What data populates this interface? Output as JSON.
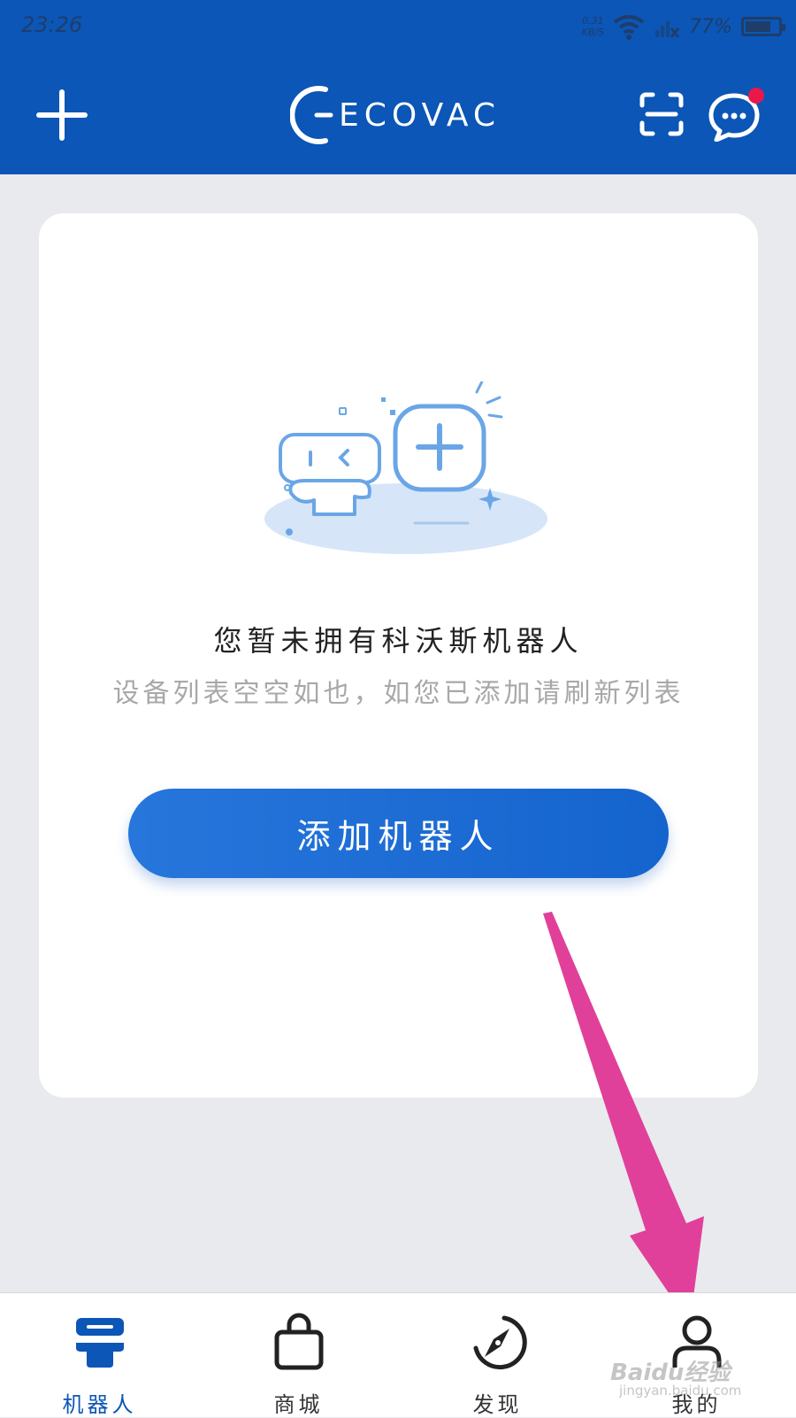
{
  "status_bar": {
    "time": "23:26",
    "net_speed_value": "0.31",
    "net_speed_unit": "KB/S",
    "battery_text": "77%",
    "battery_level": 0.77
  },
  "header": {
    "logo_text": "ECOVACS",
    "brand_color": "#0b56b6",
    "has_unread_message": true,
    "unread_badge_color": "#e8184a",
    "icons": [
      "add-icon",
      "scan-icon",
      "message-icon"
    ]
  },
  "empty_state": {
    "title": "您暂未拥有科沃斯机器人",
    "subtitle": "设备列表空空如也，如您已添加请刷新列表",
    "add_button_label": "添加机器人"
  },
  "bottom_nav": {
    "items": [
      {
        "label": "机器人",
        "icon": "robot-icon",
        "active": true
      },
      {
        "label": "商城",
        "icon": "shopping-bag-icon",
        "active": false
      },
      {
        "label": "发现",
        "icon": "compass-icon",
        "active": false
      },
      {
        "label": "我的",
        "icon": "user-icon",
        "active": false
      }
    ],
    "active_color": "#0b56b6"
  },
  "annotation": {
    "arrow_color": "#e0409a",
    "target": "我的"
  },
  "watermark": {
    "text": "Baidu经验",
    "sub_text": "jingyan.baidu.com"
  }
}
